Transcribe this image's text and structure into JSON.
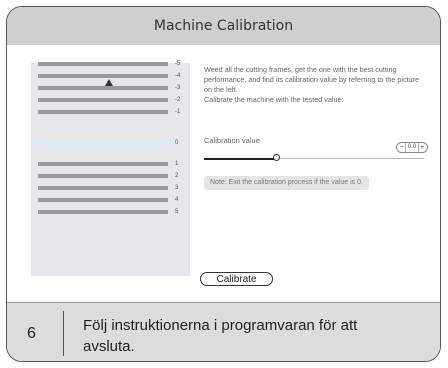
{
  "title": "Machine Calibration",
  "preview": {
    "labels": [
      "-5",
      "-4",
      "-3",
      "-2",
      "-1",
      "0",
      "1",
      "2",
      "3",
      "4",
      "5"
    ],
    "highlighted": "0"
  },
  "instructions": {
    "line1": "Weed all the cutting frames, get the one with the best cutting performance, and find its calibration value by referring to the picture on the left.",
    "line2": "Calibrate the machine with the tested value:"
  },
  "calibration": {
    "label": "Calibration value",
    "value": "0.0",
    "minus": "−",
    "plus": "+",
    "slider_fraction": 0.33
  },
  "note": "Note: Exit the calibration process if the value is 0.",
  "calibrate_button": "Calibrate",
  "step": {
    "number": "6",
    "text": "Följ instruktionerna i programvaran för att avsluta."
  },
  "colors": {
    "titlebar": "#cfcfcf",
    "highlight_bar": "#d6ecf6",
    "bar": "#9a9a9a"
  }
}
